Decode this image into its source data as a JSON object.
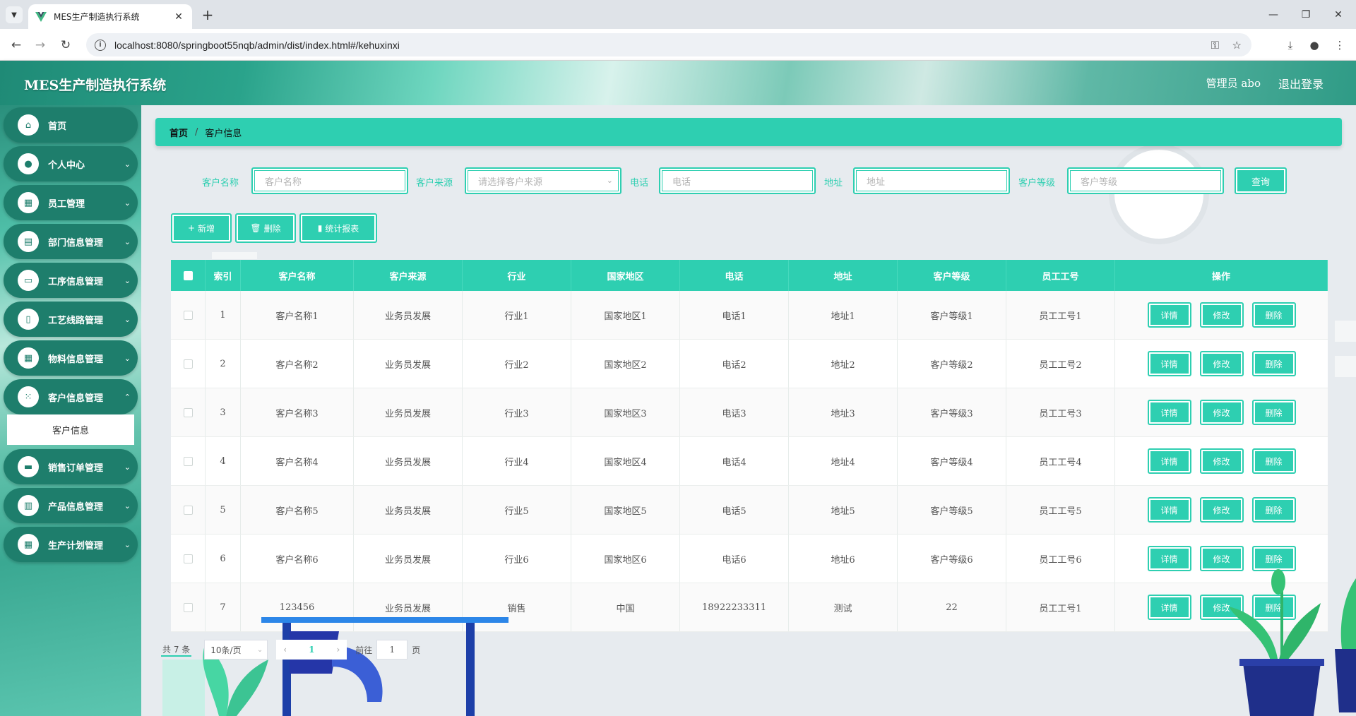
{
  "browser": {
    "tab_title": "MES生产制造执行系统",
    "url": "localhost:8080/springboot55nqb/admin/dist/index.html#/kehuxinxi"
  },
  "header": {
    "app_title": "MES生产制造执行系统",
    "user": "管理员 abo",
    "logout": "退出登录"
  },
  "sidebar": {
    "items": [
      {
        "label": "首页",
        "icon": "home-icon"
      },
      {
        "label": "个人中心",
        "icon": "user-icon"
      },
      {
        "label": "员工管理",
        "icon": "grid-icon"
      },
      {
        "label": "部门信息管理",
        "icon": "chart-icon"
      },
      {
        "label": "工序信息管理",
        "icon": "chat-icon"
      },
      {
        "label": "工艺线路管理",
        "icon": "document-icon"
      },
      {
        "label": "物料信息管理",
        "icon": "grid-icon"
      },
      {
        "label": "客户信息管理",
        "icon": "apps-icon"
      },
      {
        "label": "销售订单管理",
        "icon": "monitor-icon"
      },
      {
        "label": "产品信息管理",
        "icon": "book-icon"
      },
      {
        "label": "生产计划管理",
        "icon": "grid-icon"
      }
    ],
    "active_sub": "客户信息"
  },
  "breadcrumb": {
    "home": "首页",
    "sep": "/",
    "current": "客户信息"
  },
  "search": {
    "name_label": "客户名称",
    "name_placeholder": "客户名称",
    "source_label": "客户来源",
    "source_placeholder": "请选择客户来源",
    "phone_label": "电话",
    "phone_placeholder": "电话",
    "address_label": "地址",
    "address_placeholder": "地址",
    "level_label": "客户等级",
    "level_placeholder": "客户等级",
    "query_button": "查询"
  },
  "actions": {
    "add": "新增",
    "delete": "删除",
    "report": "统计报表"
  },
  "table": {
    "headers": [
      "索引",
      "客户名称",
      "客户来源",
      "行业",
      "国家地区",
      "电话",
      "地址",
      "客户等级",
      "员工工号",
      "操作"
    ],
    "row_buttons": {
      "detail": "详情",
      "edit": "修改",
      "delete": "删除"
    },
    "rows": [
      {
        "index": "1",
        "name": "客户名称1",
        "source": "业务员发展",
        "industry": "行业1",
        "region": "国家地区1",
        "phone": "电话1",
        "address": "地址1",
        "level": "客户等级1",
        "staff": "员工工号1"
      },
      {
        "index": "2",
        "name": "客户名称2",
        "source": "业务员发展",
        "industry": "行业2",
        "region": "国家地区2",
        "phone": "电话2",
        "address": "地址2",
        "level": "客户等级2",
        "staff": "员工工号2"
      },
      {
        "index": "3",
        "name": "客户名称3",
        "source": "业务员发展",
        "industry": "行业3",
        "region": "国家地区3",
        "phone": "电话3",
        "address": "地址3",
        "level": "客户等级3",
        "staff": "员工工号3"
      },
      {
        "index": "4",
        "name": "客户名称4",
        "source": "业务员发展",
        "industry": "行业4",
        "region": "国家地区4",
        "phone": "电话4",
        "address": "地址4",
        "level": "客户等级4",
        "staff": "员工工号4"
      },
      {
        "index": "5",
        "name": "客户名称5",
        "source": "业务员发展",
        "industry": "行业5",
        "region": "国家地区5",
        "phone": "电话5",
        "address": "地址5",
        "level": "客户等级5",
        "staff": "员工工号5"
      },
      {
        "index": "6",
        "name": "客户名称6",
        "source": "业务员发展",
        "industry": "行业6",
        "region": "国家地区6",
        "phone": "电话6",
        "address": "地址6",
        "level": "客户等级6",
        "staff": "员工工号6"
      },
      {
        "index": "7",
        "name": "123456",
        "source": "业务员发展",
        "industry": "销售",
        "region": "中国",
        "phone": "18922233311",
        "address": "测试",
        "level": "22",
        "staff": "员工工号1"
      }
    ]
  },
  "pagination": {
    "total": "共 7 条",
    "page_size": "10条/页",
    "current_page": "1",
    "goto_label": "前往",
    "goto_value": "1",
    "page_suffix": "页"
  },
  "colors": {
    "accent": "#2ecfb1",
    "menu": "#1e7e6c"
  }
}
